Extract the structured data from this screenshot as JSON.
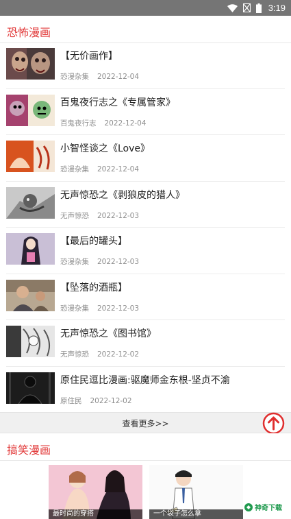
{
  "status_bar": {
    "time": "3:19"
  },
  "section_horror": {
    "title": "恐怖漫画",
    "items": [
      {
        "title": "【无价画作】",
        "category": "恐漫杂集",
        "date": "2022-12-04"
      },
      {
        "title": "百鬼夜行志之《专属管家》",
        "category": "百鬼夜行志",
        "date": "2022-12-04"
      },
      {
        "title": "小智怪谈之《Love》",
        "category": "恐漫杂集",
        "date": "2022-12-04"
      },
      {
        "title": "无声惊恐之《剥狼皮的猎人》",
        "category": "无声惊恐",
        "date": "2022-12-03"
      },
      {
        "title": "【最后的罐头】",
        "category": "恐漫杂集",
        "date": "2022-12-03"
      },
      {
        "title": "【坠落的酒瓶】",
        "category": "恐漫杂集",
        "date": "2022-12-03"
      },
      {
        "title": "无声惊恐之《图书馆》",
        "category": "无声惊恐",
        "date": "2022-12-02"
      },
      {
        "title": "原住民逗比漫画:驱魔师金东根-坚贞不渝",
        "category": "原住民",
        "date": "2022-12-02"
      }
    ],
    "more_label": "查看更多>>"
  },
  "section_funny": {
    "title": "搞笑漫画",
    "banners": [
      {
        "caption": "最时尚的穿搭"
      },
      {
        "caption": "一个袋子怎么拿"
      }
    ]
  },
  "watermark": {
    "text": "神奇下载"
  },
  "colors": {
    "accent": "#e23a3a",
    "status_bar": "#757575",
    "more_bar": "#f0f0f0"
  },
  "icons": {
    "wifi": "wifi-icon",
    "signal": "signal-off-icon",
    "battery": "battery-icon",
    "top": "arrow-up-circle-icon"
  }
}
